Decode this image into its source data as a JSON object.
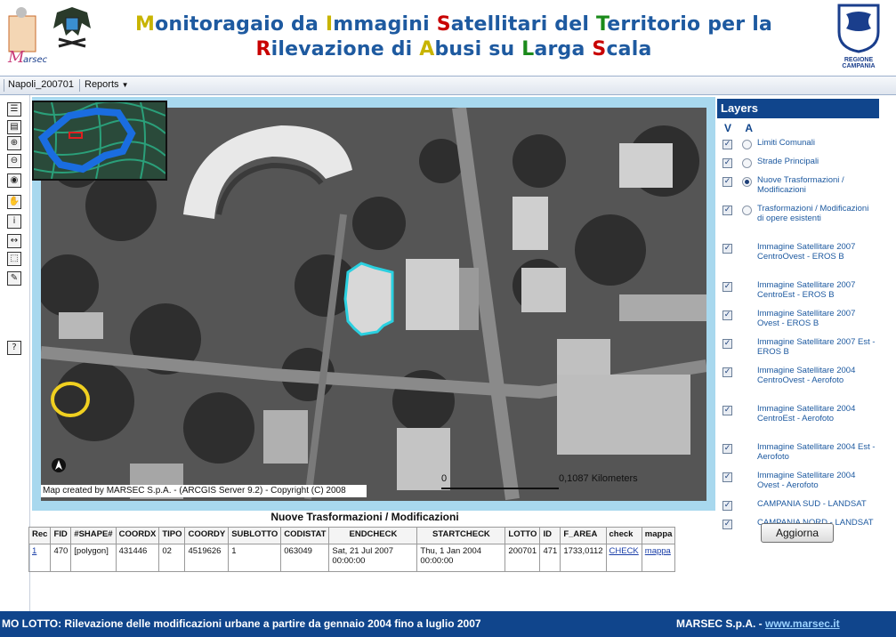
{
  "header": {
    "logo_text": "Marsec",
    "title_line1": [
      {
        "cap": "M",
        "rest": "onitoragaio da ",
        "color": "y"
      },
      {
        "cap": "I",
        "rest": "mmagini ",
        "color": "y"
      },
      {
        "cap": "S",
        "rest": "atellitari del ",
        "color": "r"
      },
      {
        "cap": "T",
        "rest": "erritorio per la",
        "color": "g"
      }
    ],
    "title_line2": [
      {
        "cap": "R",
        "rest": "ilevazione di ",
        "color": "r"
      },
      {
        "cap": "A",
        "rest": "busi su ",
        "color": "y"
      },
      {
        "cap": "L",
        "rest": "arga ",
        "color": "g"
      },
      {
        "cap": "S",
        "rest": "cala",
        "color": "r"
      }
    ],
    "region_label": "REGIONE CAMPANIA"
  },
  "toolbar": {
    "project": "Napoli_200701",
    "reports_label": "Reports"
  },
  "tools": [
    {
      "name": "toc-icon",
      "glyph": "☰"
    },
    {
      "name": "legend-icon",
      "glyph": "▤"
    },
    {
      "name": "zoom-in-icon",
      "glyph": "⊕"
    },
    {
      "name": "zoom-out-icon",
      "glyph": "⊖"
    },
    {
      "name": "full-extent-icon",
      "glyph": "◉"
    },
    {
      "name": "pan-hand-icon",
      "glyph": "✋"
    },
    {
      "name": "identify-icon",
      "glyph": "i"
    },
    {
      "name": "measure-icon",
      "glyph": "↔"
    },
    {
      "name": "select-icon",
      "glyph": "⬚"
    },
    {
      "name": "clear-selection-icon",
      "glyph": "✎"
    },
    {
      "name": "help-icon",
      "glyph": "?"
    }
  ],
  "map": {
    "credit": "Map created by MARSEC S.p.A. - (ARCGIS Server 9.2) - Copyright (C) 2008",
    "scale_start": "0",
    "scale_end": "0,1087 Kilometers",
    "north_arrow": "N"
  },
  "layers": {
    "title": "Layers",
    "col_v": "V",
    "col_a": "A",
    "items": [
      {
        "label": "Limiti Comunali",
        "checked": true,
        "radio": true,
        "selected": false
      },
      {
        "label": "Strade Principali",
        "checked": true,
        "radio": true,
        "selected": false
      },
      {
        "label": "Nuove Trasformazioni / Modificazioni",
        "checked": true,
        "radio": true,
        "selected": true
      },
      {
        "label": "Trasformazioni / Modificazioni di opere esistenti",
        "checked": true,
        "radio": true,
        "selected": false
      },
      {
        "label": "Immagine Satellitare 2007 CentroOvest - EROS B",
        "checked": true,
        "radio": false
      },
      {
        "label": "Immagine Satellitare 2007 CentroEst - EROS B",
        "checked": true,
        "radio": false
      },
      {
        "label": "Immagine Satellitare 2007 Ovest - EROS B",
        "checked": true,
        "radio": false
      },
      {
        "label": "Immagine Satellitare 2007 Est - EROS B",
        "checked": true,
        "radio": false
      },
      {
        "label": "Immagine Satellitare 2004 CentroOvest - Aerofoto",
        "checked": true,
        "radio": false
      },
      {
        "label": "Immagine Satellitare 2004 CentroEst - Aerofoto",
        "checked": true,
        "radio": false
      },
      {
        "label": "Immagine Satellitare 2004 Est - Aerofoto",
        "checked": true,
        "radio": false
      },
      {
        "label": "Immagine Satellitare 2004 Ovest - Aerofoto",
        "checked": true,
        "radio": false
      },
      {
        "label": "CAMPANIA SUD - LANDSAT",
        "checked": true,
        "radio": false
      },
      {
        "label": "CAMPANIA NORD - LANDSAT",
        "checked": true,
        "radio": false
      }
    ],
    "update_button": "Aggiorna"
  },
  "results": {
    "title": "Nuove Trasformazioni / Modificazioni",
    "columns": [
      "Rec",
      "FID",
      "#SHAPE#",
      "COORDX",
      "TIPO",
      "COORDY",
      "SUBLOTTO",
      "CODISTAT",
      "ENDCHECK",
      "STARTCHECK",
      "LOTTO",
      "ID",
      "F_AREA",
      "check",
      "mappa"
    ],
    "rows": [
      [
        "1",
        "470",
        "[polygon]",
        "431446",
        "02",
        "4519626",
        "1",
        "063049",
        "Sat, 21 Jul 2007 00:00:00",
        "Thu, 1 Jan 2004 00:00:00",
        "200701",
        "471",
        "1733,0112",
        "CHECK",
        "mappa"
      ]
    ]
  },
  "status": {
    "left_text": "MO LOTTO: Rilevazione delle modificazioni urbane a partire da gennaio 2004 fino a luglio 2007",
    "company": "MARSEC S.p.A. - ",
    "site": "www.marsec.it"
  },
  "colors": {
    "brand_blue": "#10458c",
    "title_blue": "#1e5aa0",
    "highlight_cyan": "#2ad0e0",
    "highlight_yellow": "#f0d020"
  }
}
